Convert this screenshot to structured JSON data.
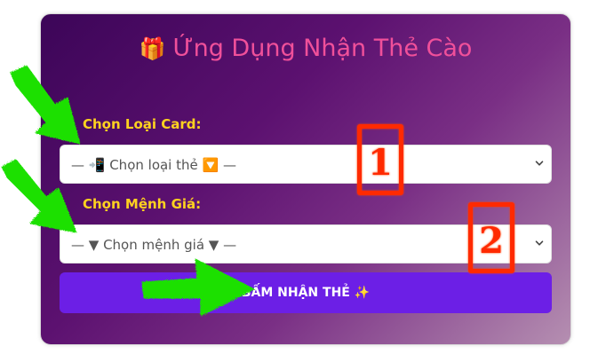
{
  "app": {
    "title": "Ứng Dụng Nhận Thẻ Cào",
    "title_icon": "🎁"
  },
  "form": {
    "card_type_label": "Chọn Loại Card:",
    "card_type_placeholder": "— 📲 Chọn loại thẻ 🔽 —",
    "denomination_label": "Chọn Mệnh Giá:",
    "denomination_placeholder": "— ▼ Chọn mệnh giá ▼ —",
    "submit_label": "BẤM NHẬN THẺ ✨"
  },
  "annotations": {
    "step_1": "1",
    "step_2": "2",
    "arrow_color": "#1fe000",
    "box_color": "#ff2a00"
  },
  "colors": {
    "title": "#f0509a",
    "label": "#ffd21f",
    "button": "#6c1fe6"
  }
}
